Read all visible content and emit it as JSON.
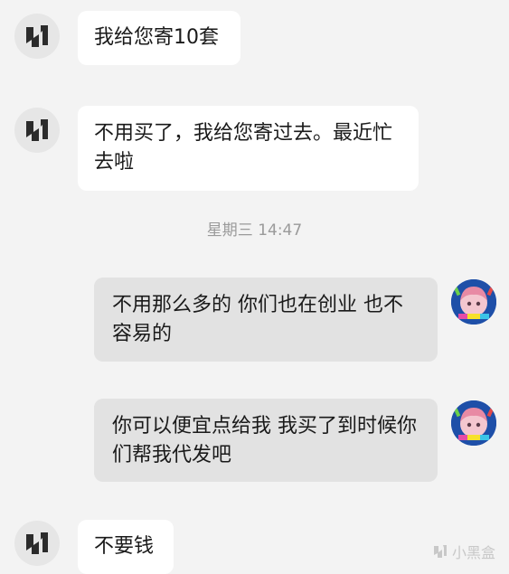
{
  "messages": [
    {
      "direction": "incoming",
      "avatar": "brand-logo",
      "text": "我给您寄10套"
    },
    {
      "direction": "incoming",
      "avatar": "brand-logo",
      "text": "不用买了，我给您寄过去。最近忙去啦"
    },
    {
      "direction": "outgoing",
      "avatar": "user-anime-avatar",
      "text": "不用那么多的 你们也在创业 也不容易的"
    },
    {
      "direction": "outgoing",
      "avatar": "user-anime-avatar",
      "text": "你可以便宜点给我 我买了到时候你们帮我代发吧"
    },
    {
      "direction": "incoming",
      "avatar": "brand-logo",
      "text": "不要钱"
    }
  ],
  "timestamp": "星期三 14:47",
  "watermark": {
    "text": "小黑盒",
    "icon": "box-logo-icon"
  },
  "colors": {
    "background": "#f3f3f3",
    "incoming_bubble": "#ffffff",
    "outgoing_bubble": "#e2e2e2",
    "timestamp": "#9a9a9a",
    "brand_logo": "#2b2b2b"
  }
}
